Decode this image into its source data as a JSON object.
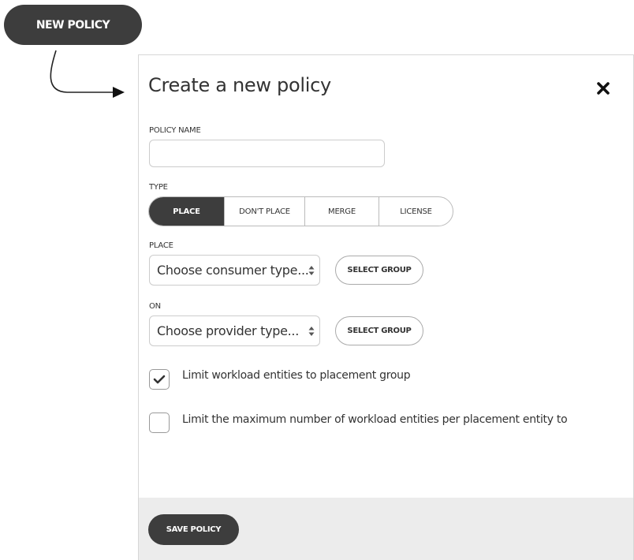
{
  "new_policy_button": {
    "label": "NEW POLICY"
  },
  "dialog": {
    "title": "Create a new policy",
    "policy_name": {
      "label": "POLICY NAME",
      "value": "",
      "placeholder": ""
    },
    "type": {
      "label": "TYPE",
      "options": [
        "PLACE",
        "DON'T PLACE",
        "MERGE",
        "LICENSE"
      ],
      "selected": "PLACE"
    },
    "place": {
      "label": "PLACE",
      "select_value": "Choose consumer type...",
      "select_group_label": "SELECT GROUP"
    },
    "on": {
      "label": "ON",
      "select_value": "Choose provider type...",
      "select_group_label": "SELECT GROUP"
    },
    "checkboxes": [
      {
        "label": "Limit workload entities to placement group",
        "checked": true
      },
      {
        "label": "Limit the maximum number of workload entities per placement entity to",
        "checked": false
      }
    ],
    "footer": {
      "save_label": "SAVE POLICY"
    }
  },
  "colors": {
    "dark_button": "#3d3d3d",
    "footer_bg": "#ececec",
    "border": "#cccccc"
  },
  "icons": {
    "close": "close-icon",
    "check": "checkmark-icon",
    "stepper": "up-down-stepper-icon",
    "arrow": "curved-arrow-icon"
  }
}
